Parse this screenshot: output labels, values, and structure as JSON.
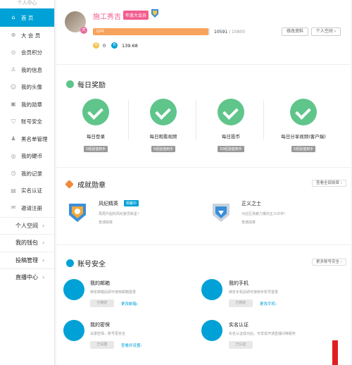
{
  "sidebar": {
    "top_label": "个人中心",
    "items": [
      {
        "label": "首    页",
        "icon": "home-icon",
        "active": true
      },
      {
        "label": "大 会 员",
        "icon": "vip-icon"
      },
      {
        "label": "会员积分",
        "icon": "points-icon"
      },
      {
        "label": "我的信息",
        "icon": "user-info-icon"
      },
      {
        "label": "我的头像",
        "icon": "avatar-icon"
      },
      {
        "label": "我的勋章",
        "icon": "medal-icon"
      },
      {
        "label": "账号安全",
        "icon": "shield-icon"
      },
      {
        "label": "黑名单管理",
        "icon": "blacklist-icon"
      },
      {
        "label": "我的硬币",
        "icon": "coin-icon"
      },
      {
        "label": "我的记录",
        "icon": "history-icon"
      },
      {
        "label": "实名认证",
        "icon": "id-card-icon"
      },
      {
        "label": "邀请注册",
        "icon": "invite-icon"
      }
    ],
    "groups": [
      {
        "label": "个人空间"
      },
      {
        "label": "我的钱包"
      },
      {
        "label": "投稿管理"
      },
      {
        "label": "直播中心"
      }
    ]
  },
  "profile": {
    "username": "施工秀吉",
    "vip_badge": "年度大会员",
    "level": "LV4",
    "exp_current": "10591",
    "exp_separator": " / ",
    "exp_max": "10800",
    "exp_progress": 0.98,
    "coins": "0",
    "bcoins": "139.68",
    "edit_label": "修改资料",
    "space_label": "个人空间 ›"
  },
  "daily": {
    "title": "每日奖励",
    "items": [
      {
        "label": "每日登录",
        "tag": "5经验值到手"
      },
      {
        "label": "每日观看视频",
        "tag": "5经验值到手"
      },
      {
        "label": "每日投币",
        "tag": "50经验值到手"
      },
      {
        "label": "每日分享视频(客户端)",
        "tag": "5经验值到手"
      }
    ]
  },
  "medals": {
    "title": "成就勋章",
    "link": "查看全部勋章 ›",
    "items": [
      {
        "name": "风纪精英",
        "tag": "佩戴中",
        "desc": "再再升起的风纪委员新星！",
        "status": "普通勋章"
      },
      {
        "name": "正义之士",
        "tag": "",
        "desc": "为社区贡献力量的正义伙伴！",
        "status": "普通勋章"
      }
    ]
  },
  "security": {
    "title": "账号安全",
    "link": "更多账号安全 ›",
    "items": [
      {
        "title": "我的邮箱",
        "desc": "绑定邮箱后即可使用邮箱登录",
        "button": "已绑定",
        "link": "更改邮箱›",
        "icon": "mail-icon"
      },
      {
        "title": "我的手机",
        "desc": "绑定手机后即可使用手机号登录",
        "button": "已绑定",
        "link": "更改手机›",
        "icon": "phone-icon"
      },
      {
        "title": "我的密保",
        "desc": "设置密保，账号更安全",
        "button": "已设置",
        "link": "查看并设置›",
        "icon": "question-icon"
      },
      {
        "title": "实名认证",
        "desc": "实名认证成功后，可享受开通直播间等服务",
        "button": "已认证",
        "link": "",
        "icon": "id-card-icon"
      }
    ]
  },
  "colors": {
    "accent": "#00a1d6",
    "pink": "#f25d8e",
    "green": "#5fc58a",
    "orange": "#f7a35c"
  }
}
